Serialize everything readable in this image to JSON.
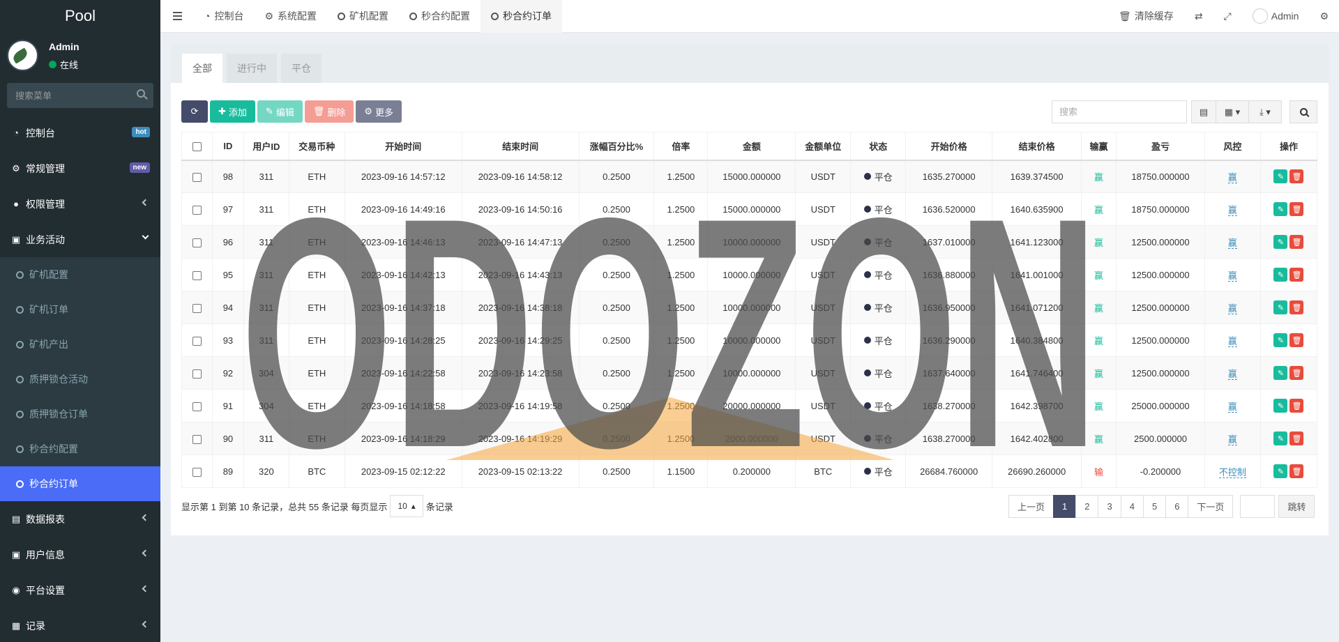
{
  "sidebar": {
    "logo": "Pool",
    "user": {
      "name": "Admin",
      "status": "在线"
    },
    "search_placeholder": "搜索菜单",
    "menu": [
      {
        "label": "控制台",
        "badge": "hot",
        "badge_color": "#3c8dbc"
      },
      {
        "label": "常规管理",
        "badge": "new",
        "badge_color": "#605ca8"
      },
      {
        "label": "权限管理"
      },
      {
        "label": "业务活动"
      }
    ],
    "sub_items": [
      "矿机配置",
      "矿机订单",
      "矿机产出",
      "质押锁仓活动",
      "质押锁仓订单",
      "秒合约配置",
      "秒合约订单"
    ],
    "menu_after": [
      {
        "label": "数据报表"
      },
      {
        "label": "用户信息"
      },
      {
        "label": "平台设置"
      },
      {
        "label": "记录"
      }
    ]
  },
  "topbar": {
    "tabs": [
      "控制台",
      "系统配置",
      "矿机配置",
      "秒合约配置",
      "秒合约订单"
    ],
    "clear_cache": "清除缓存",
    "admin": "Admin"
  },
  "panel": {
    "tabs": [
      "全部",
      "进行中",
      "平仓"
    ],
    "toolbar": {
      "add": "添加",
      "edit": "编辑",
      "delete": "删除",
      "more": "更多"
    },
    "search_placeholder": "搜索"
  },
  "table": {
    "headers": [
      "ID",
      "用户ID",
      "交易币种",
      "开始时间",
      "结束时间",
      "涨幅百分比%",
      "倍率",
      "金额",
      "金额单位",
      "状态",
      "开始价格",
      "结束价格",
      "输赢",
      "盈亏",
      "风控",
      "操作"
    ],
    "rows": [
      [
        "98",
        "311",
        "ETH",
        "2023-09-16 14:57:12",
        "2023-09-16 14:58:12",
        "0.2500",
        "1.2500",
        "15000.000000",
        "USDT",
        "平仓",
        "1635.270000",
        "1639.374500",
        "赢",
        "18750.000000",
        "赢"
      ],
      [
        "97",
        "311",
        "ETH",
        "2023-09-16 14:49:16",
        "2023-09-16 14:50:16",
        "0.2500",
        "1.2500",
        "15000.000000",
        "USDT",
        "平仓",
        "1636.520000",
        "1640.635900",
        "赢",
        "18750.000000",
        "赢"
      ],
      [
        "96",
        "311",
        "ETH",
        "2023-09-16 14:46:13",
        "2023-09-16 14:47:13",
        "0.2500",
        "1.2500",
        "10000.000000",
        "USDT",
        "平仓",
        "1637.010000",
        "1641.123000",
        "赢",
        "12500.000000",
        "赢"
      ],
      [
        "95",
        "311",
        "ETH",
        "2023-09-16 14:42:13",
        "2023-09-16 14:43:13",
        "0.2500",
        "1.2500",
        "10000.000000",
        "USDT",
        "平仓",
        "1636.880000",
        "1641.001000",
        "赢",
        "12500.000000",
        "赢"
      ],
      [
        "94",
        "311",
        "ETH",
        "2023-09-16 14:37:18",
        "2023-09-16 14:38:18",
        "0.2500",
        "1.2500",
        "10000.000000",
        "USDT",
        "平仓",
        "1636.950000",
        "1641.071200",
        "赢",
        "12500.000000",
        "赢"
      ],
      [
        "93",
        "311",
        "ETH",
        "2023-09-16 14:28:25",
        "2023-09-16 14:29:25",
        "0.2500",
        "1.2500",
        "10000.000000",
        "USDT",
        "平仓",
        "1636.290000",
        "1640.384800",
        "赢",
        "12500.000000",
        "赢"
      ],
      [
        "92",
        "304",
        "ETH",
        "2023-09-16 14:22:58",
        "2023-09-16 14:23:58",
        "0.2500",
        "1.2500",
        "10000.000000",
        "USDT",
        "平仓",
        "1637.640000",
        "1641.746400",
        "赢",
        "12500.000000",
        "赢"
      ],
      [
        "91",
        "304",
        "ETH",
        "2023-09-16 14:18:58",
        "2023-09-16 14:19:58",
        "0.2500",
        "1.2500",
        "20000.000000",
        "USDT",
        "平仓",
        "1638.270000",
        "1642.398700",
        "赢",
        "25000.000000",
        "赢"
      ],
      [
        "90",
        "311",
        "ETH",
        "2023-09-16 14:18:29",
        "2023-09-16 14:19:29",
        "0.2500",
        "1.2500",
        "2000.000000",
        "USDT",
        "平仓",
        "1638.270000",
        "1642.402800",
        "赢",
        "2500.000000",
        "赢"
      ],
      [
        "89",
        "320",
        "BTC",
        "2023-09-15 02:12:22",
        "2023-09-15 02:13:22",
        "0.2500",
        "1.1500",
        "0.200000",
        "BTC",
        "平仓",
        "26684.760000",
        "26690.260000",
        "输",
        "-0.200000",
        "不控制"
      ]
    ]
  },
  "footer": {
    "info_prefix": "显示第 1 到第 10 条记录，总共 55 条记录 每页显示",
    "page_size": "10",
    "info_suffix": "条记录",
    "prev": "上一页",
    "pages": [
      "1",
      "2",
      "3",
      "4",
      "5",
      "6"
    ],
    "next": "下一页",
    "jump": "跳转"
  },
  "watermark": {
    "text": "ODOZON"
  },
  "colors": {
    "sidebar_bg": "#222d32",
    "accent": "#4a6cf7",
    "primary_dark": "#444c69",
    "success": "#18bc9c",
    "danger": "#e74c3c"
  }
}
